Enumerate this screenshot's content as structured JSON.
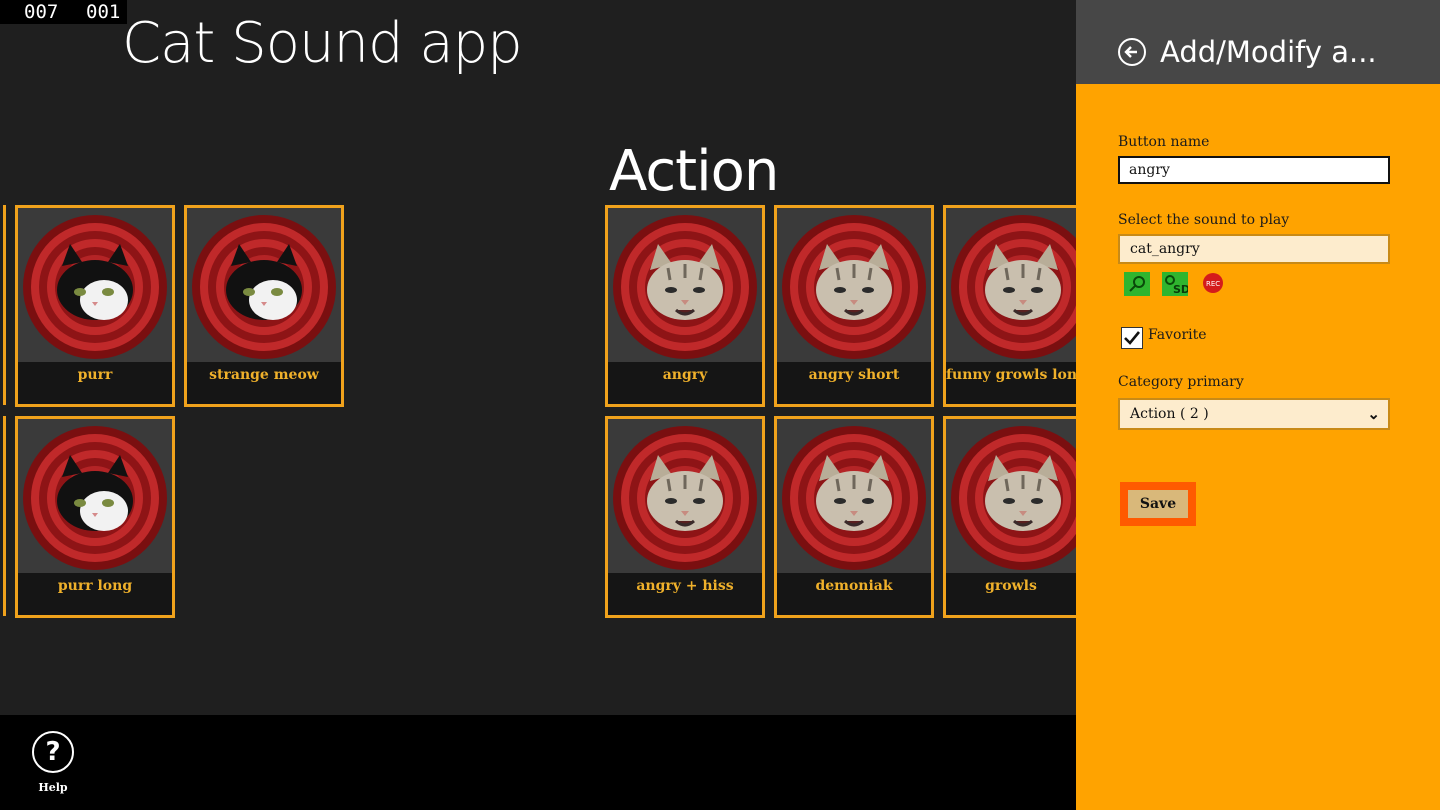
{
  "debug_counters": [
    "007",
    "001"
  ],
  "app": {
    "title": "Cat Sound app"
  },
  "groups": [
    {
      "title": "",
      "tiles": [
        {
          "label": "purr",
          "cat": "black-white"
        },
        {
          "label": "strange meow",
          "cat": "black-white"
        },
        {
          "label": "purr long",
          "cat": "black-white"
        }
      ]
    },
    {
      "title": "Action",
      "tiles": [
        {
          "label": "angry",
          "cat": "tabby"
        },
        {
          "label": "angry short",
          "cat": "tabby"
        },
        {
          "label": "funny growls lon",
          "cat": "tabby"
        },
        {
          "label": "angry + hiss",
          "cat": "tabby"
        },
        {
          "label": "demoniak",
          "cat": "tabby"
        },
        {
          "label": "growls",
          "cat": "tabby"
        }
      ]
    }
  ],
  "appbar": {
    "help_label": "Help",
    "help_icon": "help-icon"
  },
  "panel": {
    "title": "Add/Modify a...",
    "back_icon": "back-arrow-icon",
    "button_name_label": "Button name",
    "button_name_value": "angry",
    "sound_label": "Select the sound to play",
    "sound_value": "cat_angry",
    "sound_icons": [
      "search-icon",
      "sd-card-icon",
      "record-icon"
    ],
    "favorite_label": "Favorite",
    "favorite_checked": true,
    "category_label": "Category primary",
    "category_value": "Action ( 2 )",
    "save_label": "Save"
  },
  "colors": {
    "accent": "#f0a21c",
    "panel_bg": "#ffa300",
    "panel_header": "#474747",
    "save_highlight": "#ff5a00",
    "page_bg": "#1f1f1f"
  }
}
